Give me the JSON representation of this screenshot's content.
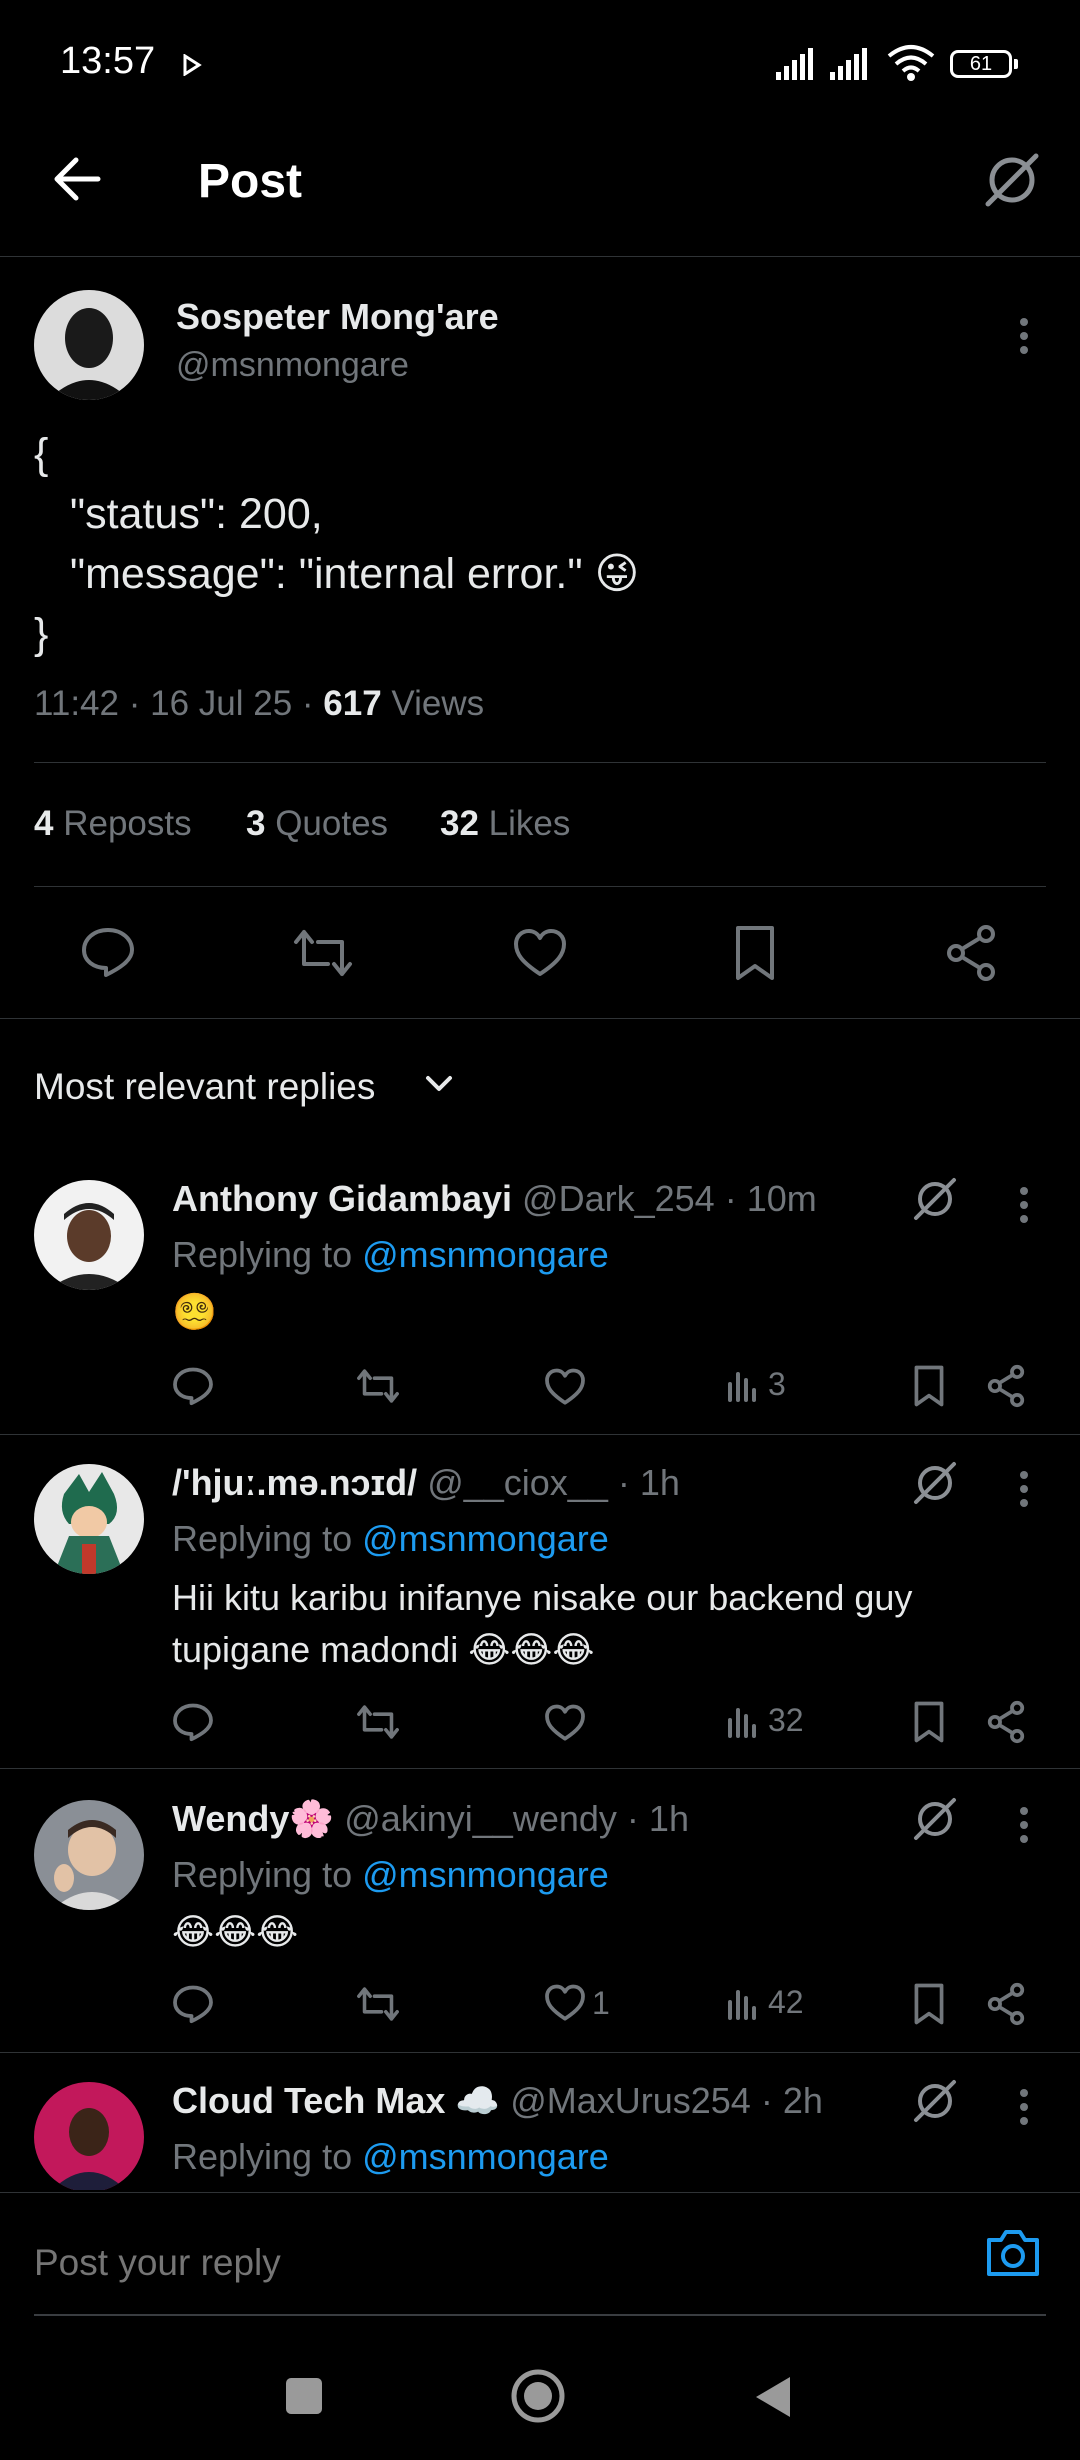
{
  "status_bar": {
    "time": "13:57",
    "battery": "61"
  },
  "header": {
    "title": "Post"
  },
  "post": {
    "author_name": "Sospeter Mong'are",
    "author_handle": "@msnmongare",
    "text": "{\n   \"status\": 200,\n   \"message\": \"internal error.\" 😜\n}",
    "time": "11:42",
    "date": "16 Jul 25",
    "views_count": "617",
    "views_label": "Views",
    "reposts_count": "4",
    "reposts_label": "Reposts",
    "quotes_count": "3",
    "quotes_label": "Quotes",
    "likes_count": "32",
    "likes_label": "Likes"
  },
  "replies_sort": {
    "label": "Most relevant replies"
  },
  "replies": [
    {
      "name": "Anthony Gidambayi",
      "handle": "@Dark_254",
      "time": "10m",
      "replying_prefix": "Replying to",
      "replying_to": "@msnmongare",
      "text": "😵‍💫",
      "likes": "",
      "views": "3"
    },
    {
      "name": "/'hjuː.mə.nɔɪd/",
      "handle": "@__ciox__",
      "time": "1h",
      "replying_prefix": "Replying to",
      "replying_to": "@msnmongare",
      "text": "Hii kitu karibu inifanye nisake our backend guy tupigane madondi 😂😂😂",
      "likes": "",
      "views": "32"
    },
    {
      "name": "Wendy🌸",
      "handle": "@akinyi__wendy",
      "time": "1h",
      "replying_prefix": "Replying to",
      "replying_to": "@msnmongare",
      "text": "😂😂😂",
      "likes": "1",
      "views": "42"
    },
    {
      "name": "Cloud Tech Max ☁️",
      "handle": "@MaxUrus254",
      "time": "2h",
      "replying_prefix": "Replying to",
      "replying_to": "@msnmongare",
      "text": "",
      "likes": "",
      "views": ""
    }
  ],
  "reply_box": {
    "placeholder": "Post your reply"
  },
  "colors": {
    "background": "#000000",
    "accent": "#1d9bf0",
    "muted": "#71767b",
    "divider": "#2f3336"
  }
}
